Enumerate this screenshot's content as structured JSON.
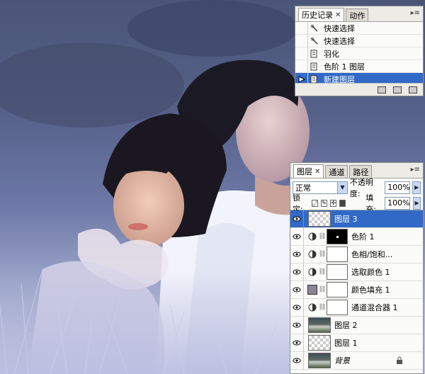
{
  "history_panel": {
    "tabs": [
      {
        "label": "历史记录",
        "active": true
      },
      {
        "label": "动作",
        "active": false
      }
    ],
    "items": [
      {
        "label": "快速选择",
        "icon": "quick-selection-icon",
        "selected": false
      },
      {
        "label": "快速选择",
        "icon": "quick-selection-icon",
        "selected": false
      },
      {
        "label": "羽化",
        "icon": "history-state-icon",
        "selected": false
      },
      {
        "label": "色阶 1 图层",
        "icon": "history-state-icon",
        "selected": false
      },
      {
        "label": "新建图层",
        "icon": "history-state-icon",
        "selected": true
      }
    ],
    "selection_color": "#3169c6"
  },
  "layers_panel": {
    "tabs": [
      {
        "label": "图层",
        "active": true
      },
      {
        "label": "通道",
        "active": false
      },
      {
        "label": "路径",
        "active": false
      }
    ],
    "blend_mode": "正常",
    "opacity_label": "不透明度:",
    "opacity_value": "100%",
    "lock_label": "锁定:",
    "fill_label": "填充:",
    "fill_value": "100%",
    "layers": [
      {
        "name": "图层 3",
        "kind": "transparent",
        "selected": true
      },
      {
        "name": "色阶 1",
        "kind": "adjustment-levels",
        "selected": false
      },
      {
        "name": "色相/饱和...",
        "kind": "adjustment",
        "selected": false
      },
      {
        "name": "选取颜色 1",
        "kind": "adjustment",
        "selected": false
      },
      {
        "name": "颜色填充 1",
        "kind": "color-fill",
        "fill_color": "#8a8498",
        "selected": false
      },
      {
        "name": "通道混合器 1",
        "kind": "adjustment",
        "selected": false
      },
      {
        "name": "图层 2",
        "kind": "photo",
        "selected": false
      },
      {
        "name": "图层 1",
        "kind": "transparent",
        "selected": false
      },
      {
        "name": "背景",
        "kind": "photo-locked",
        "selected": false
      }
    ]
  }
}
